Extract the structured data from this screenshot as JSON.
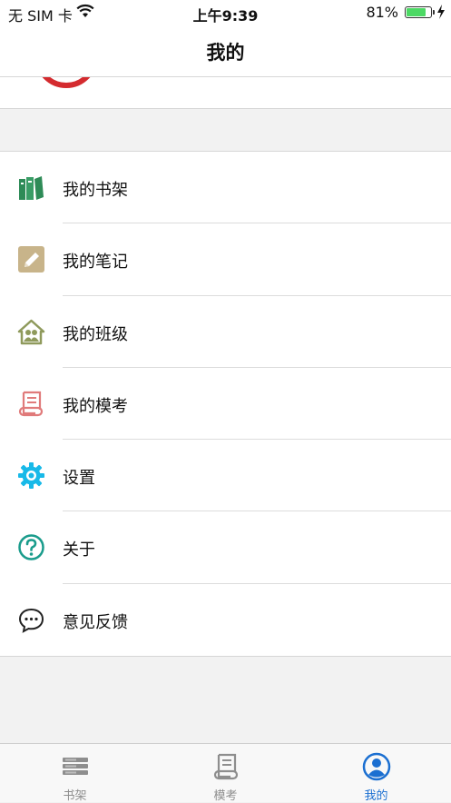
{
  "status_bar": {
    "carrier": "无 SIM 卡",
    "time": "上午9:39",
    "battery_pct": "81%",
    "battery_level": 0.81
  },
  "nav": {
    "title": "我的"
  },
  "menu": {
    "items": [
      {
        "label": "我的书架",
        "icon": "bookshelf-icon",
        "color": "#2e8b57"
      },
      {
        "label": "我的笔记",
        "icon": "notes-icon",
        "color": "#c8b48a"
      },
      {
        "label": "我的班级",
        "icon": "class-icon",
        "color": "#8f9a5c"
      },
      {
        "label": "我的模考",
        "icon": "exam-icon",
        "color": "#e07a7a"
      },
      {
        "label": "设置",
        "icon": "gear-icon",
        "color": "#18b9e8"
      },
      {
        "label": "关于",
        "icon": "question-icon",
        "color": "#1a9c8c"
      },
      {
        "label": "意见反馈",
        "icon": "feedback-icon",
        "color": "#222222"
      }
    ]
  },
  "tab_bar": {
    "tabs": [
      {
        "label": "书架",
        "icon": "bookshelf-tab-icon",
        "active": false
      },
      {
        "label": "模考",
        "icon": "exam-tab-icon",
        "active": false
      },
      {
        "label": "我的",
        "icon": "user-tab-icon",
        "active": true
      }
    ],
    "active_color": "#1b6fd1",
    "inactive_color": "#8e8e8e"
  }
}
